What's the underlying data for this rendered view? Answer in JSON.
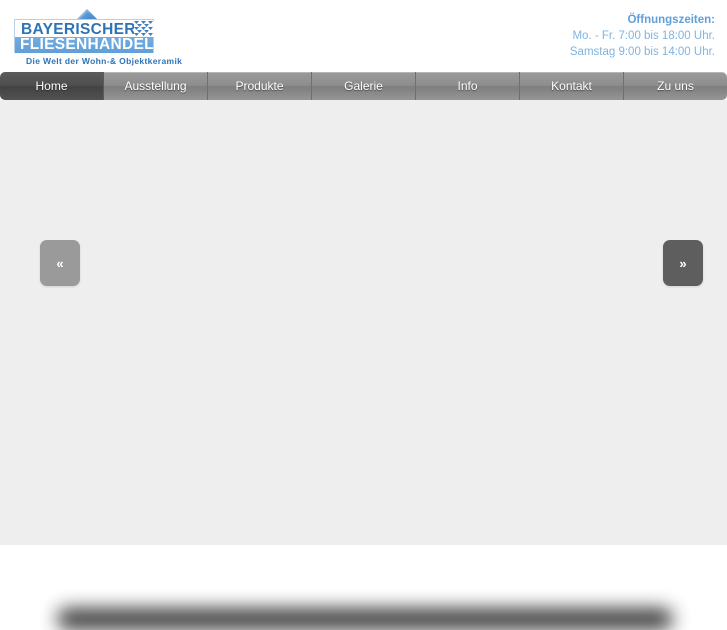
{
  "header": {
    "logo": {
      "line1": "BAYERISCHER",
      "line2": "FLIESENHANDEL",
      "tagline": "Die Welt der Wohn-& Objektkeramik",
      "diamond_icon": "blue-diamond-icon",
      "flag_icon": "bavarian-lozenge-icon",
      "brand_color": "#2e74b5",
      "bar_color": "#6aa6dd"
    },
    "hours": {
      "title": "Öffnungszeiten:",
      "lines": [
        "Mo. - Fr. 7:00 bis 18:00 Uhr.",
        "Samstag 9:00 bis 14:00 Uhr."
      ],
      "title_color": "#5fa0d8",
      "line_color": "#7fb4e2"
    }
  },
  "nav": {
    "items": [
      {
        "label": "Home",
        "active": true
      },
      {
        "label": "Ausstellung",
        "active": false
      },
      {
        "label": "Produkte",
        "active": false
      },
      {
        "label": "Galerie",
        "active": false
      },
      {
        "label": "Info",
        "active": false
      },
      {
        "label": "Kontakt",
        "active": false
      },
      {
        "label": "Zu uns",
        "active": false
      }
    ],
    "active_color": "#4a4a4a",
    "base_color": "#8d8d8d"
  },
  "slider": {
    "prev_label": "«",
    "next_label": "»",
    "prev_icon": "chevron-double-left-icon",
    "next_icon": "chevron-double-right-icon",
    "background_color": "#eeeeee"
  }
}
